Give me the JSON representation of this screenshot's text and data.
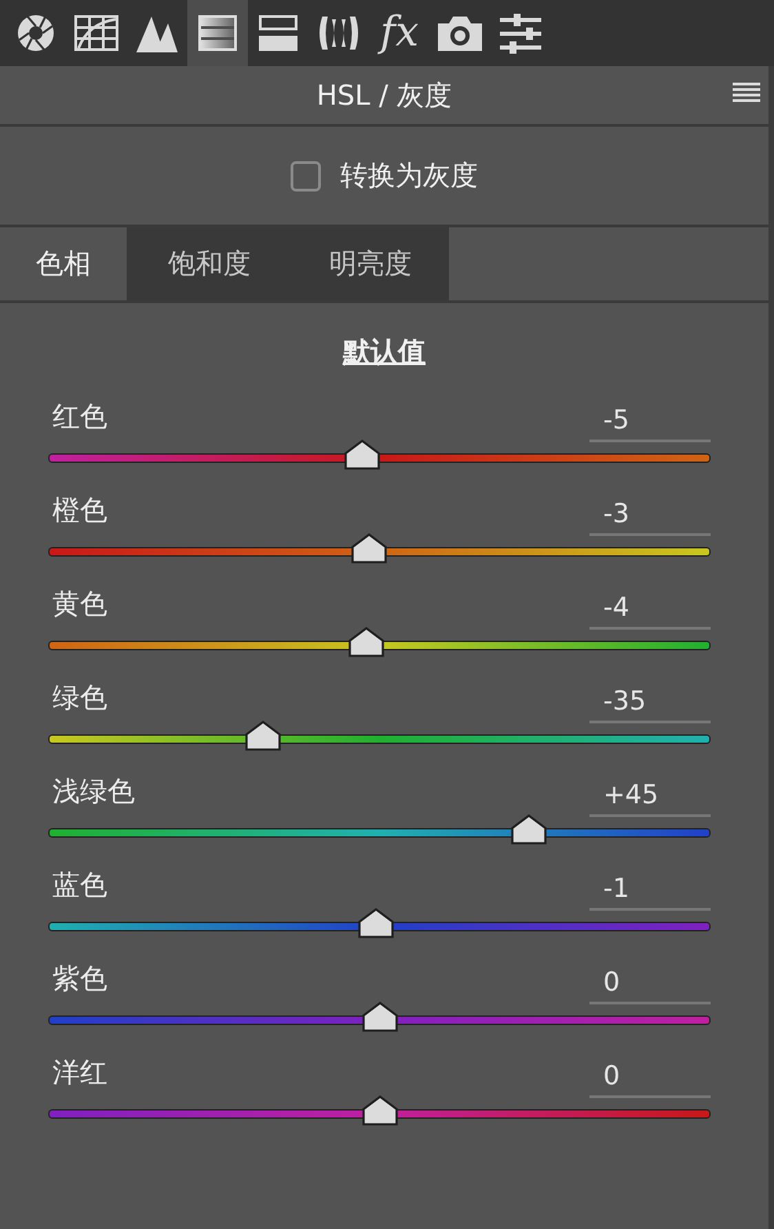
{
  "toolbar": [
    {
      "kind": "aperture",
      "selected": false
    },
    {
      "kind": "curve",
      "selected": false
    },
    {
      "kind": "peaks",
      "selected": false
    },
    {
      "kind": "hsl",
      "selected": true
    },
    {
      "kind": "split",
      "selected": false
    },
    {
      "kind": "lens",
      "selected": false
    },
    {
      "kind": "fx",
      "label": "fx",
      "selected": false
    },
    {
      "kind": "camera",
      "selected": false
    },
    {
      "kind": "sliders",
      "selected": false
    }
  ],
  "panel": {
    "title": "HSL / 灰度"
  },
  "grayscale": {
    "label": "转换为灰度",
    "checked": false
  },
  "tabs": [
    {
      "label": "色相",
      "selected": true
    },
    {
      "label": "饱和度",
      "selected": false
    },
    {
      "label": "明亮度",
      "selected": false
    }
  ],
  "default_link": "默认值",
  "sliders": [
    {
      "name": "红色",
      "reading": "-5",
      "level": 0.475,
      "color": "#c81818"
    },
    {
      "name": "橙色",
      "reading": "-3",
      "level": 0.485,
      "color": "#d06414"
    },
    {
      "name": "黄色",
      "reading": "-4",
      "level": 0.48,
      "color": "#c8c820"
    },
    {
      "name": "绿色",
      "reading": "-35",
      "level": 0.325,
      "color": "#20b030"
    },
    {
      "name": "浅绿色",
      "reading": "+45",
      "level": 0.725,
      "color": "#20b0b0"
    },
    {
      "name": "蓝色",
      "reading": "-1",
      "level": 0.495,
      "color": "#2040c8"
    },
    {
      "name": "紫色",
      "reading": "0",
      "level": 0.5,
      "color": "#8020c0"
    },
    {
      "name": "洋红",
      "reading": "0",
      "level": 0.5,
      "color": "#c020a0"
    }
  ]
}
